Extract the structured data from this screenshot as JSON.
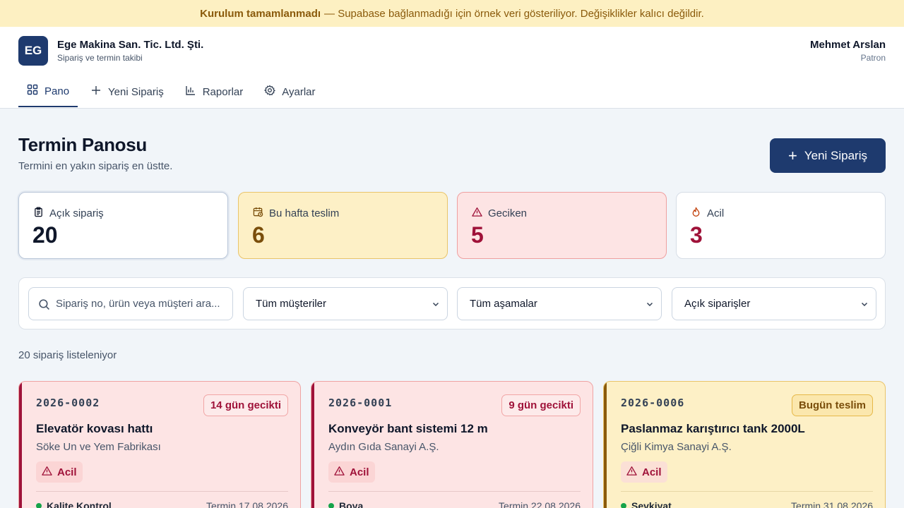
{
  "banner": {
    "bold": "Kurulum tamamlanmadı",
    "text": "— Supabase bağlanmadığı için örnek veri gösteriliyor. Değişiklikler kalıcı değildir."
  },
  "company": {
    "initials": "EG",
    "name": "Ege Makina San. Tic. Ltd. Şti.",
    "subtitle": "Sipariş ve termin takibi"
  },
  "user": {
    "name": "Mehmet Arslan",
    "role": "Patron"
  },
  "nav": [
    {
      "label": "Pano",
      "icon": "grid-icon",
      "active": true
    },
    {
      "label": "Yeni Sipariş",
      "icon": "plus-icon",
      "active": false
    },
    {
      "label": "Raporlar",
      "icon": "bar-chart-icon",
      "active": false
    },
    {
      "label": "Ayarlar",
      "icon": "gear-icon",
      "active": false
    }
  ],
  "page": {
    "title": "Termin Panosu",
    "subtitle": "Termini en yakın sipariş en üstte.",
    "new_order_button": "Yeni Sipariş"
  },
  "stats": {
    "open": {
      "label": "Açık sipariş",
      "value": "20",
      "icon": "clipboard-icon"
    },
    "week": {
      "label": "Bu hafta teslim",
      "value": "6",
      "icon": "calendar-clock-icon"
    },
    "late": {
      "label": "Geciken",
      "value": "5",
      "icon": "warning-triangle-icon"
    },
    "urgent": {
      "label": "Acil",
      "value": "3",
      "icon": "flame-icon"
    }
  },
  "filters": {
    "search_placeholder": "Sipariş no, ürün veya müşteri ara...",
    "customer": "Tüm müşteriler",
    "stage": "Tüm aşamalar",
    "status": "Açık siparişler"
  },
  "list_count": "20 sipariş listeleniyor",
  "orders": [
    {
      "no": "2026-0002",
      "badge": "14 gün gecikti",
      "title": "Elevatör kovası hattı",
      "customer": "Söke Un ve Yem Fabrikası",
      "urgent": "Acil",
      "stage": "Kalite Kontrol",
      "due": "Termin 17.08.2026",
      "state": "late"
    },
    {
      "no": "2026-0001",
      "badge": "9 gün gecikti",
      "title": "Konveyör bant sistemi 12 m",
      "customer": "Aydın Gıda Sanayi A.Ş.",
      "urgent": "Acil",
      "stage": "Boya",
      "due": "Termin 22.08.2026",
      "state": "late"
    },
    {
      "no": "2026-0006",
      "badge": "Bugün teslim",
      "title": "Paslanmaz karıştırıcı tank 2000L",
      "customer": "Çiğli Kimya Sanayi A.Ş.",
      "urgent": "Acil",
      "stage": "Sevkiyat",
      "due": "Termin 31.08.2026",
      "state": "today"
    }
  ],
  "colors": {
    "brand": "#1e3a6e",
    "banner_bg": "#fdf0c2",
    "late_bg": "#fde4e4",
    "today_bg": "#fdf0c6",
    "danger": "#9f1239",
    "stage_dot": "#16a34a"
  }
}
